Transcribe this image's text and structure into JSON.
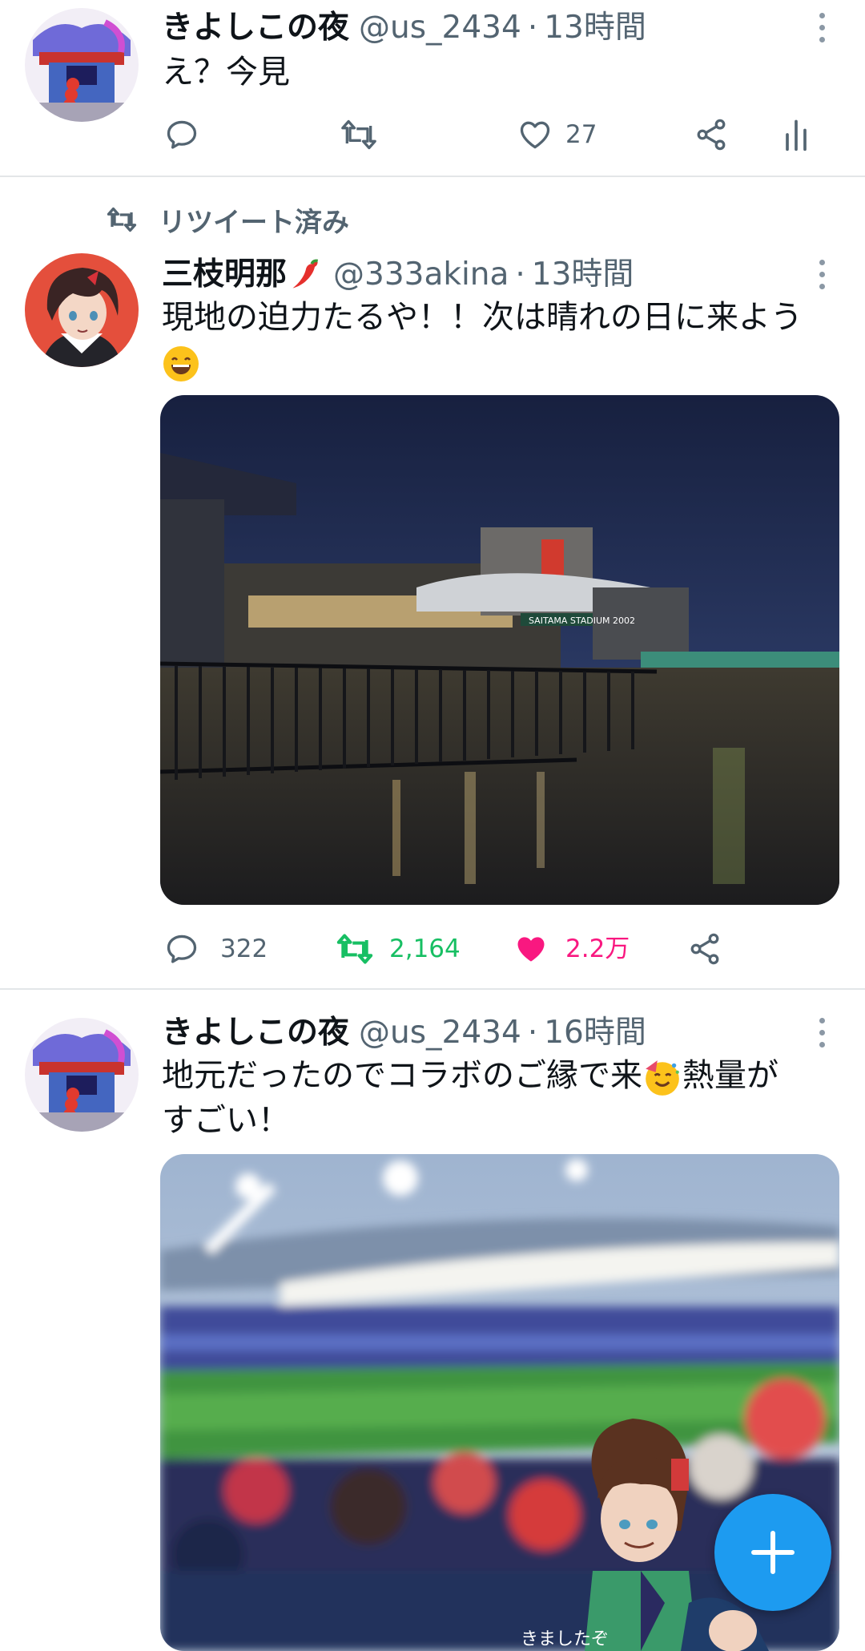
{
  "tweets": [
    {
      "name": "きよしこの夜",
      "handle": "@us_2434",
      "time": "13時間",
      "text": "え？今見",
      "reply_count": "",
      "retweet_count": "",
      "like_count": "27"
    },
    {
      "retweeted_label": "リツイート済み",
      "name": "三枝明那",
      "handle": "@333akina",
      "time": "13時間",
      "text_line1": "現地の迫力たるや！！次は晴れの日に来よう",
      "reply_count": "322",
      "retweet_count": "2,164",
      "like_count": "2.2万",
      "media": {
        "stadium_sign": "SAITAMA STADIUM 2002"
      }
    },
    {
      "name": "きよしこの夜",
      "handle": "@us_2434",
      "time": "16時間",
      "text_line1a": "地元だったのでコラボのご縁で来",
      "text_line1b": "熱量が",
      "text_line2": "すごい！",
      "media": {
        "handwriting": "きましたぞ"
      }
    }
  ],
  "separator": "·",
  "icons": {
    "reply": "reply-icon",
    "retweet": "retweet-icon",
    "like": "heart-icon",
    "share": "share-icon",
    "analytics": "analytics-icon",
    "more": "more-options-icon",
    "compose": "compose-plus-icon"
  },
  "colors": {
    "retweet_active": "#17bf63",
    "like_active": "#f91880",
    "fab": "#1d9bf0",
    "secondary_text": "#536471"
  }
}
